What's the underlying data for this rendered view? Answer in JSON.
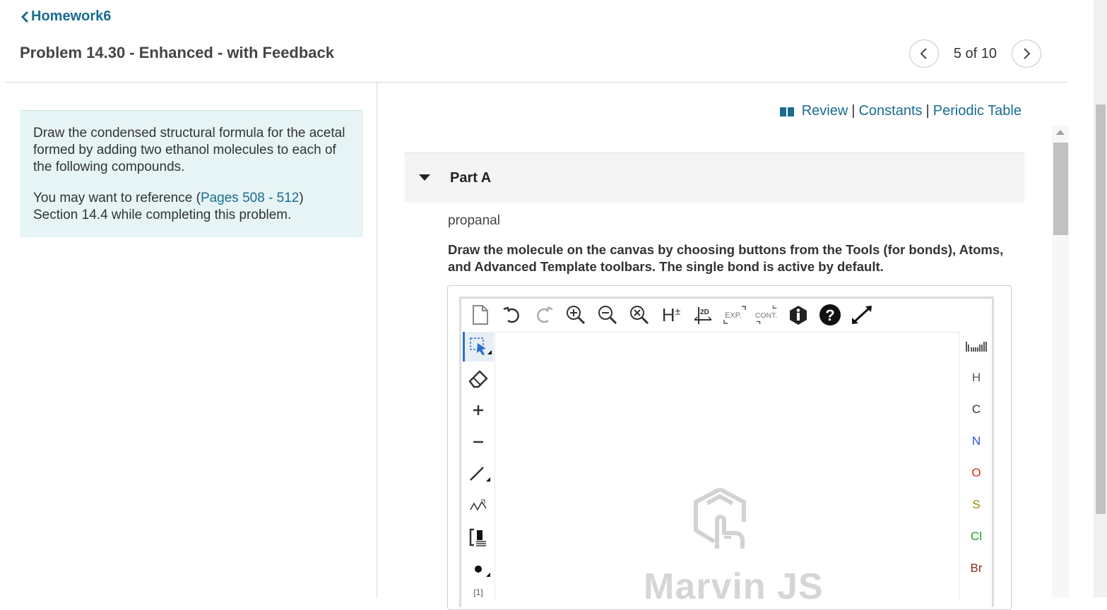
{
  "nav": {
    "back_label": "Homework6"
  },
  "header": {
    "title": "Problem 14.30 - Enhanced - with Feedback"
  },
  "pager": {
    "count_text": "5 of 10",
    "prev_icon": "chevron-left-icon",
    "next_icon": "chevron-right-icon"
  },
  "intro": {
    "paragraph1": "Draw the condensed structural formula for the acetal formed by adding two ethanol molecules to each of the following compounds.",
    "ref_prefix": "You may want to reference (",
    "ref_link": "Pages 508 - 512",
    "ref_suffix": ")",
    "ref_line2": "Section 14.4 while completing this problem."
  },
  "resources": {
    "review": "Review",
    "constants": "Constants",
    "periodic_table": "Periodic Table",
    "separator": "|",
    "icon": "book-icon",
    "link_color": "#1a6c8f"
  },
  "part": {
    "label": "Part A",
    "compound": "propanal",
    "instruction": "Draw the molecule on the canvas by choosing buttons from the Tools (for bonds), Atoms, and Advanced Template toolbars. The single bond is active by default."
  },
  "toolbar": {
    "top": [
      "new-document",
      "undo",
      "redo",
      "zoom-in",
      "zoom-out",
      "zoom-reset",
      "implicit-hydrogens",
      "clean-2d",
      "expand",
      "contract",
      "info",
      "help",
      "fullscreen"
    ],
    "h_label": "H",
    "h_sup": "±",
    "clean_label": "2D",
    "expand_label": "EXP.",
    "contract_label": "CONT.",
    "left": [
      "select",
      "erase",
      "charge-plus",
      "charge-minus",
      "single-bond",
      "chain",
      "bracket",
      "radical"
    ],
    "left_last_label": "[1]"
  },
  "atoms": [
    {
      "symbol": "H",
      "color": "#555555"
    },
    {
      "symbol": "C",
      "color": "#333333"
    },
    {
      "symbol": "N",
      "color": "#3050d0"
    },
    {
      "symbol": "O",
      "color": "#e02020"
    },
    {
      "symbol": "S",
      "color": "#9a8a00"
    },
    {
      "symbol": "Cl",
      "color": "#1f9a1f"
    },
    {
      "symbol": "Br",
      "color": "#8a2a2a"
    }
  ],
  "canvas": {
    "watermark": "Marvin JS"
  }
}
